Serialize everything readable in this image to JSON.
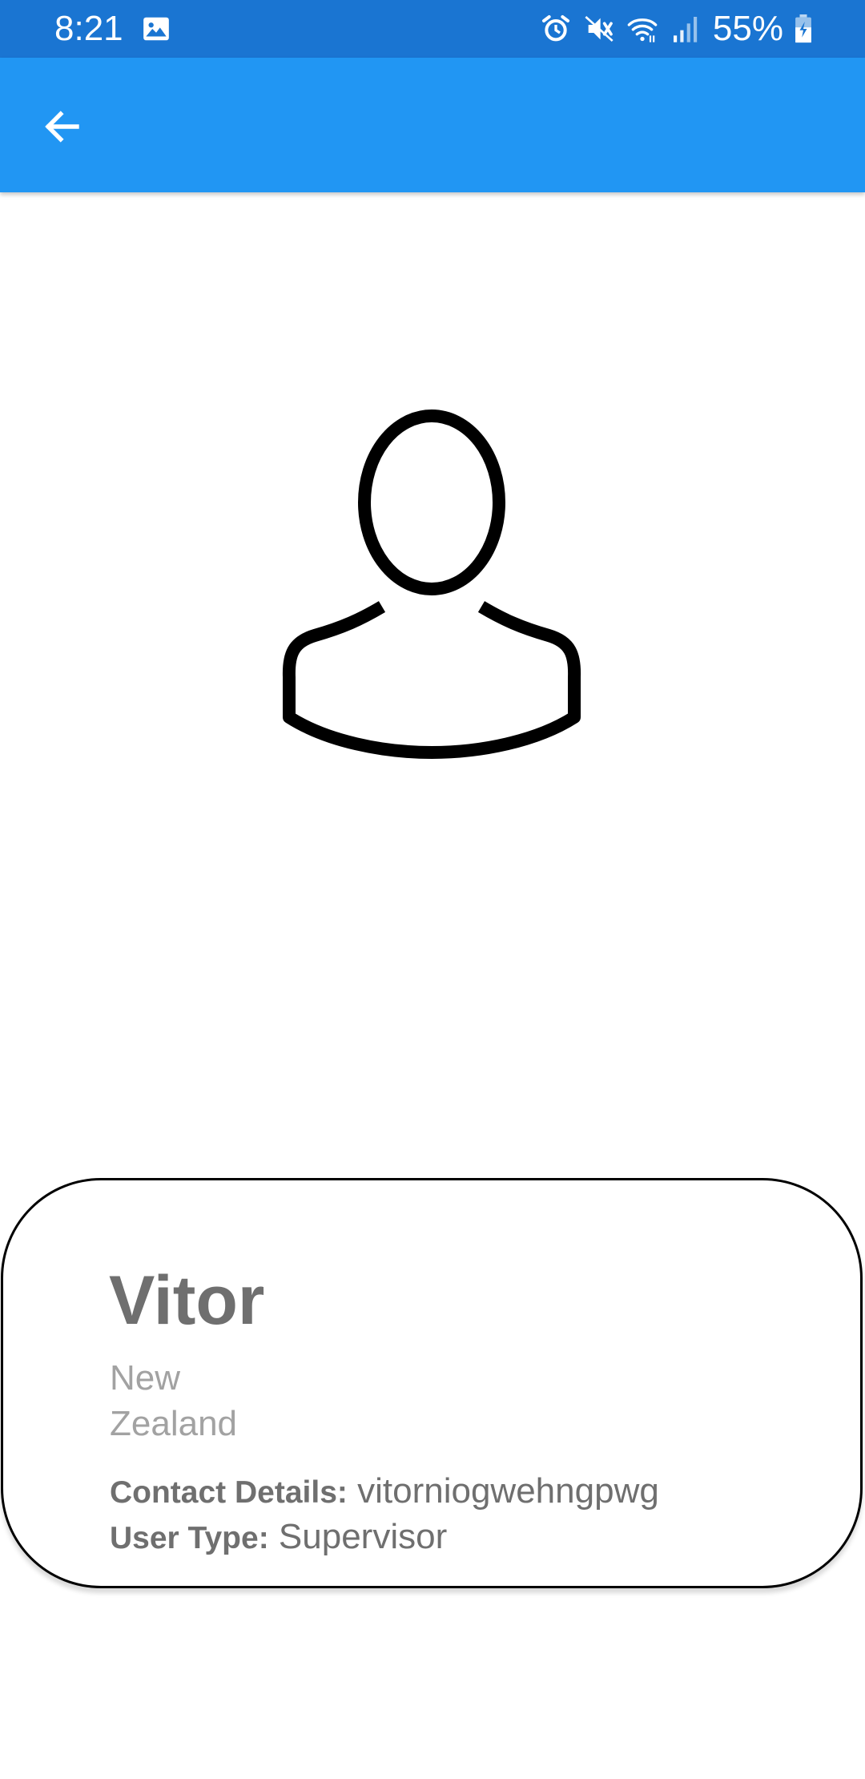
{
  "status_bar": {
    "time": "8:21",
    "battery": "55%",
    "icons": [
      "gallery-icon",
      "alarm-icon",
      "mute-icon",
      "wifi-icon",
      "signal-icon",
      "battery-icon"
    ],
    "background_color": "#1a75d2"
  },
  "app_bar": {
    "back_icon": "arrow-left-icon",
    "background_color": "#2196f3"
  },
  "avatar": {
    "icon": "user-silhouette-icon"
  },
  "profile": {
    "name": "Vitor",
    "country": "New Zealand",
    "contact_label": "Contact Details:",
    "contact_value": "vitorniogwehngpwg",
    "user_type_label": "User Type:",
    "user_type_value": "Supervisor"
  }
}
